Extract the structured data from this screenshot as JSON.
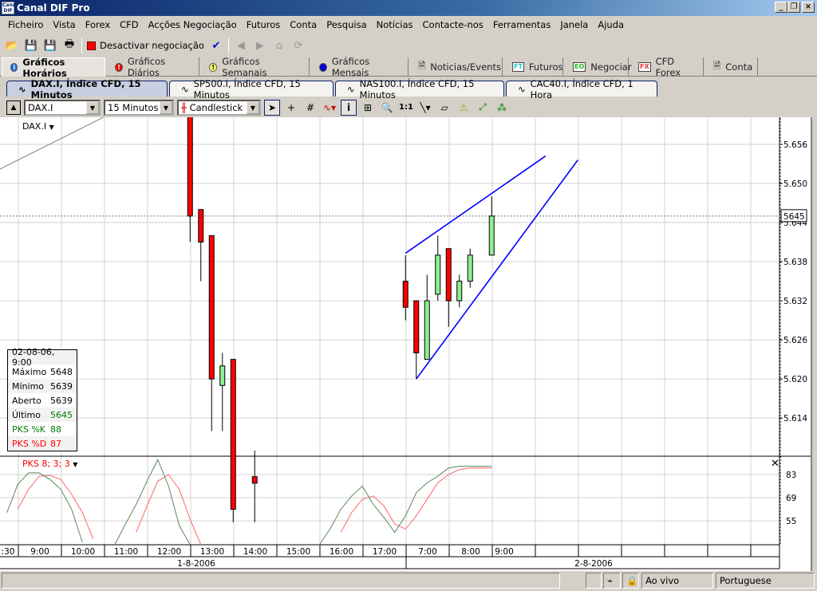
{
  "window": {
    "title": "Canal DIF Pro",
    "logo_text": "Canal DIF",
    "controls": [
      "minimize",
      "restore",
      "close"
    ]
  },
  "menu": [
    "Ficheiro",
    "Vista",
    "Forex",
    "CFD",
    "Acções Negociação",
    "Futuros",
    "Conta",
    "Pesquisa",
    "Notícias",
    "Contacte-nos",
    "Ferramentas",
    "Janela",
    "Ajuda"
  ],
  "toolbar": {
    "trading_toggle_label": "Desactivar negociação",
    "trading_color": "#ff0000"
  },
  "main_tabs": [
    {
      "label": "Gráficos Horários",
      "icon": "info-blue",
      "active": true
    },
    {
      "label": "Gráficos Diários",
      "icon": "alert-red"
    },
    {
      "label": "Gráficos Semanais",
      "icon": "alert-yellow"
    },
    {
      "label": "Gráficos Mensais",
      "icon": "dot-blue"
    },
    {
      "label": "Noticias/Events",
      "icon": "document"
    },
    {
      "label": "Futuros",
      "icon": "FT"
    },
    {
      "label": "Negociar",
      "icon": "EO"
    },
    {
      "label": "CFD Forex",
      "icon": "FX"
    },
    {
      "label": "Conta",
      "icon": "document-check"
    }
  ],
  "chart_tabs": [
    {
      "label": "DAX.I, Índice CFD, 15 Minutos",
      "active": true
    },
    {
      "label": "SP500.I, Índice CFD, 15 Minutos"
    },
    {
      "label": "NAS100.I, Índice CFD, 15 Minutos"
    },
    {
      "label": "CAC40.I, Índice CFD, 1 Hora"
    }
  ],
  "chart_toolbar": {
    "symbol": "DAX.I",
    "interval": "15 Minutos",
    "chart_type": "Candlestick",
    "zoom_ratio": "1:1"
  },
  "chart": {
    "symbol_label": "DAX.I",
    "price_ticks": [
      "5.656",
      "5.650",
      "5.644",
      "5.638",
      "5.632",
      "5.626",
      "5.620",
      "5.614"
    ],
    "current_price_label": "5645",
    "current_price": 5645,
    "time_labels": [
      ":30",
      "9:00",
      "10:00",
      "11:00",
      "12:00",
      "13:00",
      "14:00",
      "15:00",
      "16:00",
      "17:00",
      "7:00",
      "8:00",
      "9:00"
    ],
    "dates": [
      "1-8-2006",
      "2-8-2006"
    ],
    "up_color": "#90ee90",
    "down_color": "#ff0000",
    "trendline_color": "#0000ff",
    "candles": [
      {
        "date": "1-8-2006",
        "time": "13:00",
        "o": 5662,
        "h": 5670,
        "l": 5641,
        "c": 5645
      },
      {
        "date": "1-8-2006",
        "time": "13:15",
        "o": 5646,
        "h": 5646,
        "l": 5635,
        "c": 5641
      },
      {
        "date": "1-8-2006",
        "time": "13:30",
        "o": 5642,
        "h": 5642,
        "l": 5612,
        "c": 5620
      },
      {
        "date": "1-8-2006",
        "time": "13:45",
        "o": 5619,
        "h": 5624,
        "l": 5612,
        "c": 5622
      },
      {
        "date": "1-8-2006",
        "time": "14:00",
        "o": 5623,
        "h": 5623,
        "l": 5598,
        "c": 5600
      },
      {
        "date": "1-8-2006",
        "time": "14:30",
        "o": 5605,
        "h": 5609,
        "l": 5598,
        "c": 5604
      },
      {
        "date": "2-8-2006",
        "time": "7:00",
        "o": 5635,
        "h": 5639,
        "l": 5629,
        "c": 5631
      },
      {
        "date": "2-8-2006",
        "time": "7:15",
        "o": 5632,
        "h": 5632,
        "l": 5620,
        "c": 5624
      },
      {
        "date": "2-8-2006",
        "time": "7:30",
        "o": 5623,
        "h": 5636,
        "l": 5623,
        "c": 5632
      },
      {
        "date": "2-8-2006",
        "time": "7:45",
        "o": 5633,
        "h": 5642,
        "l": 5632,
        "c": 5639
      },
      {
        "date": "2-8-2006",
        "time": "8:00",
        "o": 5640,
        "h": 5640,
        "l": 5628,
        "c": 5632
      },
      {
        "date": "2-8-2006",
        "time": "8:15",
        "o": 5632,
        "h": 5636,
        "l": 5631,
        "c": 5635
      },
      {
        "date": "2-8-2006",
        "time": "8:30",
        "o": 5635,
        "h": 5640,
        "l": 5634,
        "c": 5639
      },
      {
        "date": "2-8-2006",
        "time": "9:00",
        "o": 5639,
        "h": 5648,
        "l": 5639,
        "c": 5645
      }
    ],
    "trendlines": [
      {
        "color": "#0000ff",
        "from": {
          "date": "2-8-2006",
          "time": "7:00",
          "price": 5639.3
        },
        "to": {
          "date": "2-8-2006",
          "time": "10:15",
          "price": 5654.2
        }
      },
      {
        "color": "#0000ff",
        "from": {
          "date": "2-8-2006",
          "time": "7:15",
          "price": 5620
        },
        "to": {
          "date": "2-8-2006",
          "time": "11:00",
          "price": 5653.6
        }
      },
      {
        "color": "#808080",
        "from": {
          "date": "1-8-2006",
          "time": "8:35",
          "price": 5652.2
        },
        "to": {
          "date": "1-8-2006",
          "time": "11:00",
          "price": 5660.2
        }
      }
    ]
  },
  "info_box": {
    "header": "02-08-06, 9:00",
    "rows": [
      {
        "label": "Máximo",
        "value": "5648",
        "color": "#000000"
      },
      {
        "label": "Mínimo",
        "value": "5639",
        "color": "#000000"
      },
      {
        "label": "Aberto",
        "value": "5639",
        "color": "#000000"
      },
      {
        "label": "Último",
        "value": "5645",
        "color": "#008000",
        "label_color": "#000000"
      },
      {
        "label": "PKS %K",
        "value": "88",
        "color": "#008000",
        "label_color": "#008000"
      },
      {
        "label": "PKS %D",
        "value": "87",
        "color": "#ff0000",
        "label_color": "#ff0000"
      }
    ]
  },
  "oscillator": {
    "label": "PKS 8; 3; 3",
    "ticks": [
      "83",
      "69",
      "55"
    ],
    "k_color": "#5a8a5a",
    "d_color": "#ff6666",
    "k": [
      60,
      77,
      84,
      84,
      80,
      74,
      62,
      42,
      null,
      null,
      40,
      53,
      65,
      79,
      92,
      76,
      52,
      40,
      null,
      null,
      null,
      null,
      null,
      null,
      null,
      null,
      null,
      null,
      null,
      40,
      50,
      62,
      70,
      76,
      65,
      57,
      48,
      58,
      72,
      78,
      82,
      87,
      88,
      88,
      88,
      88
    ],
    "d": [
      null,
      62,
      74,
      82,
      82.5,
      80,
      71,
      60,
      44,
      null,
      null,
      null,
      48,
      64,
      79,
      83,
      74,
      56,
      40,
      null,
      null,
      null,
      null,
      null,
      null,
      null,
      null,
      null,
      null,
      null,
      null,
      48,
      60,
      68,
      70,
      64,
      53,
      50,
      58,
      68,
      78,
      83,
      86,
      87,
      87,
      87
    ]
  },
  "status_bar": {
    "connection": "Ao vivo",
    "language": "Portuguese"
  }
}
